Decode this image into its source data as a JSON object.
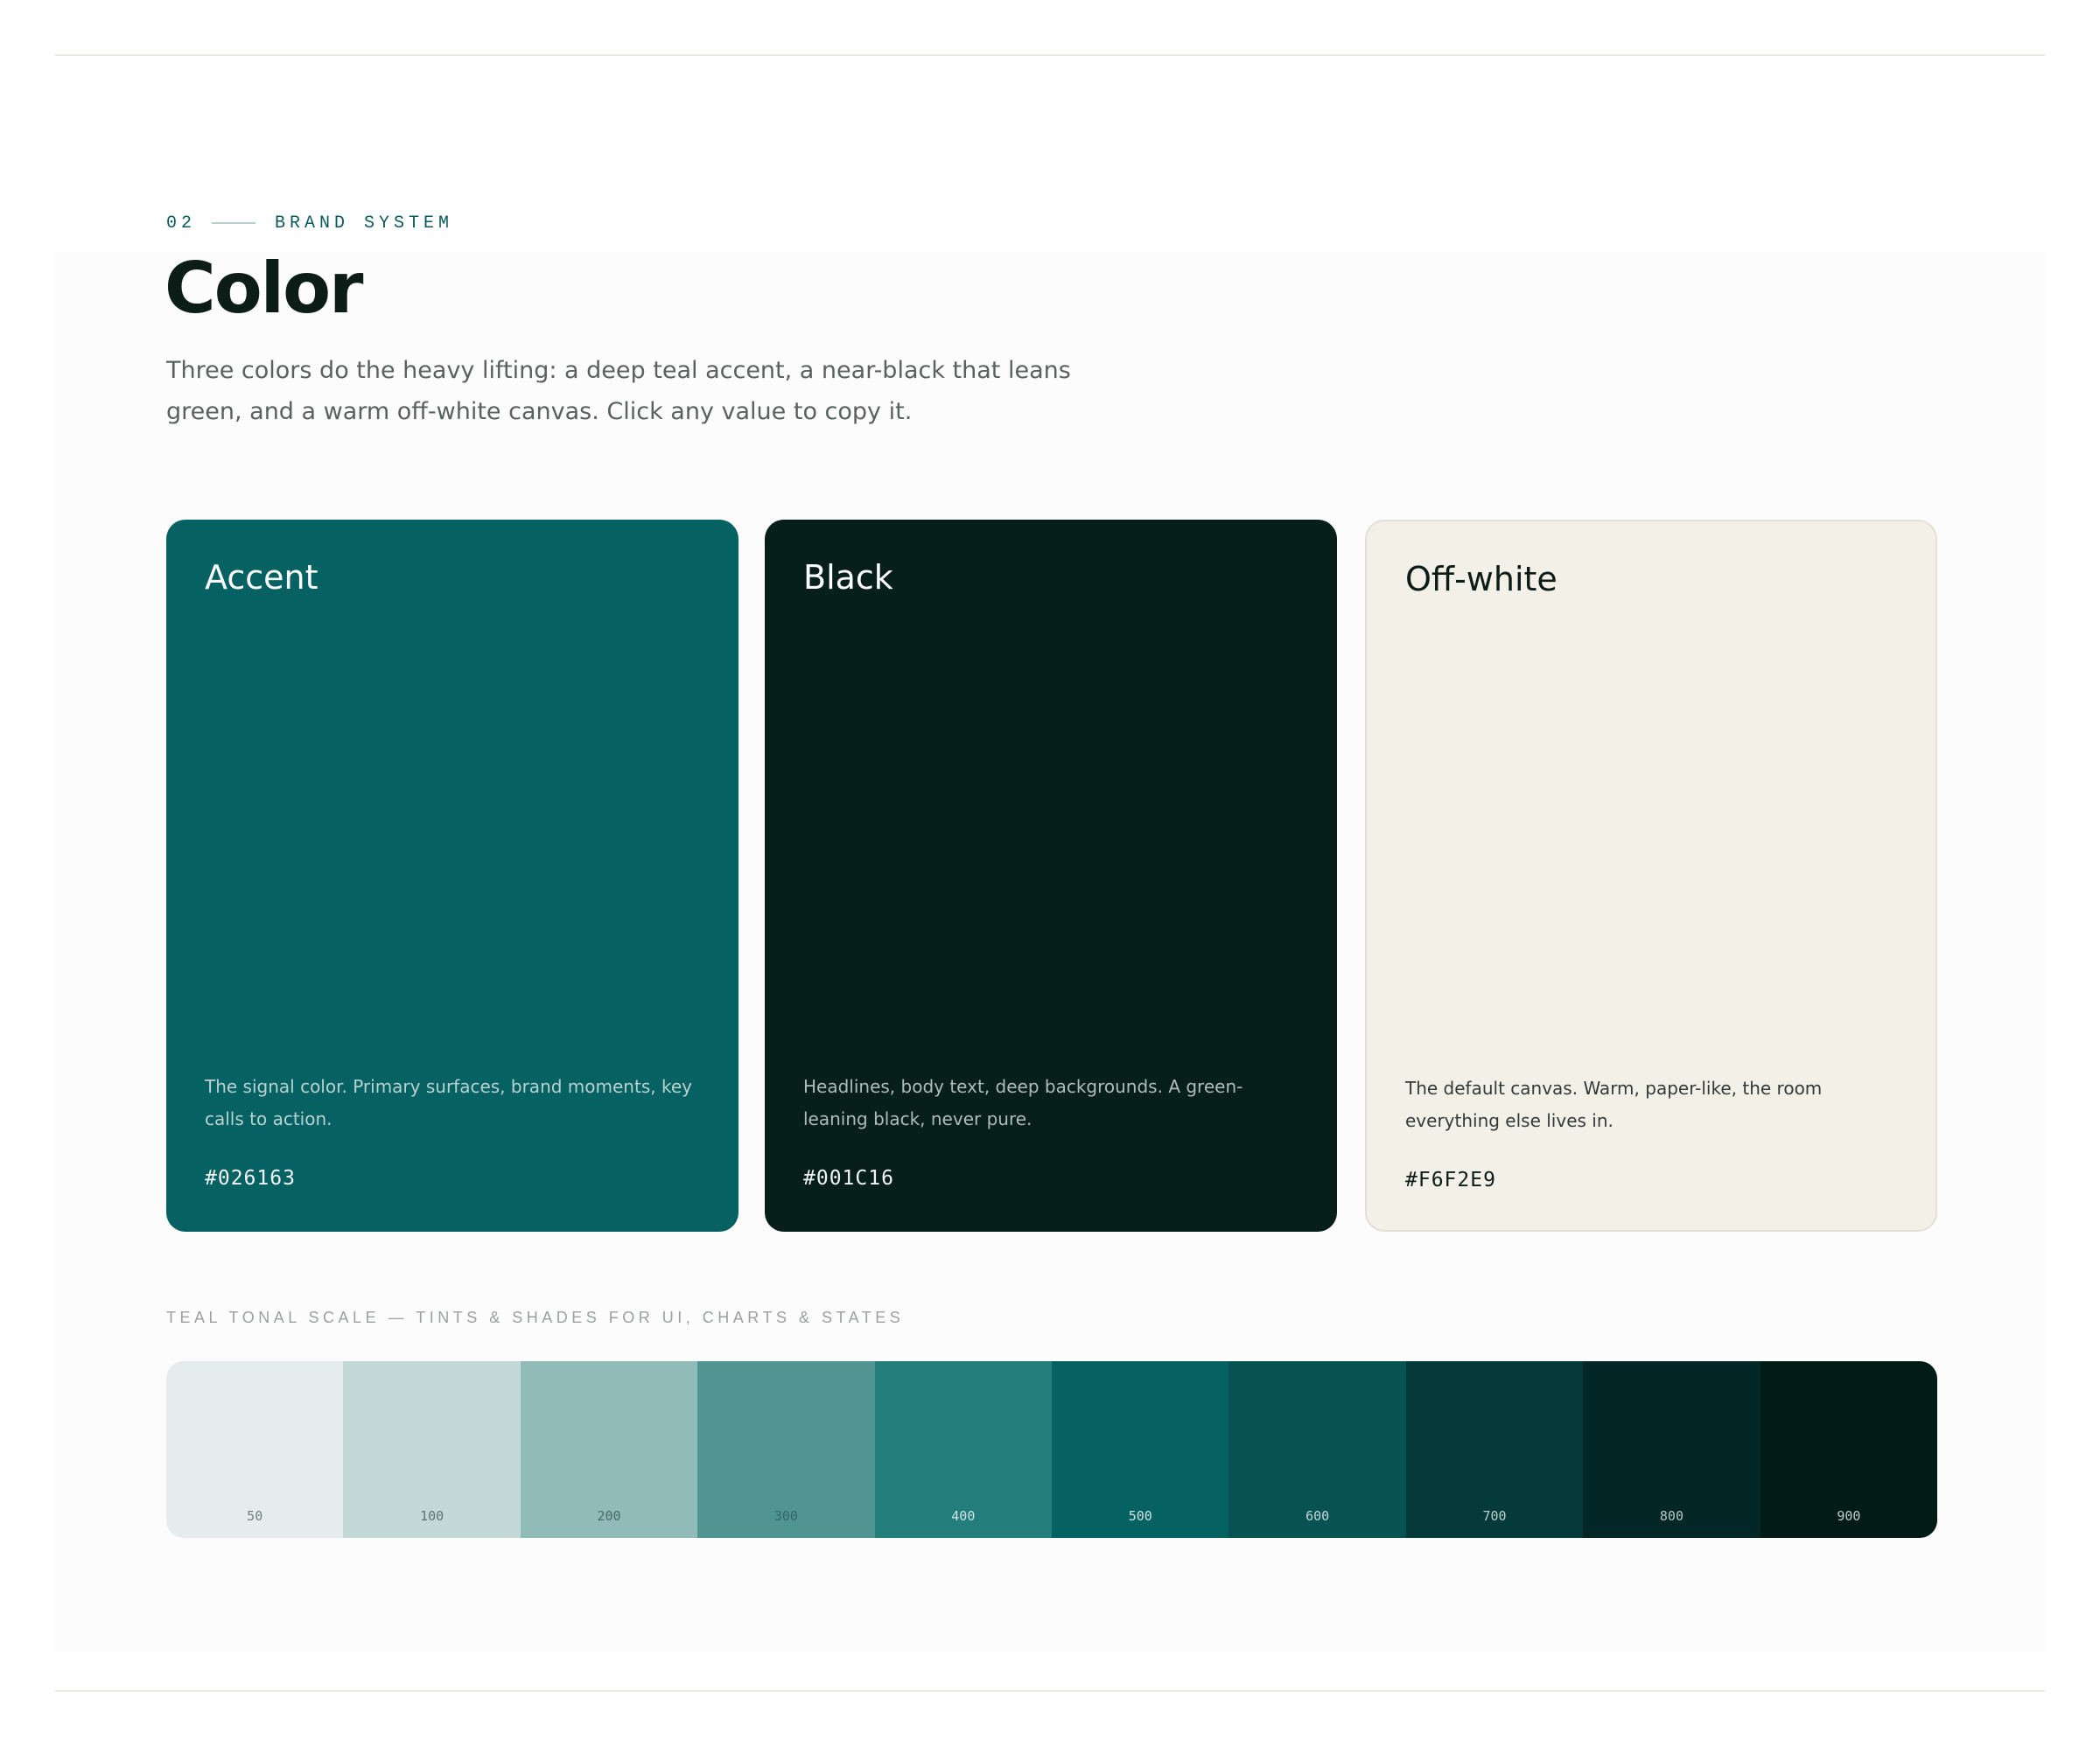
{
  "section": {
    "number": "02",
    "eyebrow": "BRAND SYSTEM",
    "title": "Color",
    "intro": "Three colors do the heavy lifting: a deep teal accent, a near-black that leans green, and a warm off-white canvas. Click any value to copy it."
  },
  "cards": [
    {
      "name": "Accent",
      "description": "The signal color. Primary surfaces, brand moments, key calls to action.",
      "hex": "#026163",
      "color": "#066163"
    },
    {
      "name": "Black",
      "description": "Headlines, body text, deep backgrounds. A green-leaning black, never pure.",
      "hex": "#001C16",
      "color": "#061F19"
    },
    {
      "name": "Off-white",
      "description": "The default canvas. Warm, paper-like, the room everything else lives in.",
      "hex": "#F6F2E9",
      "color": "#F3F0E8"
    }
  ],
  "scale": {
    "label": "TEAL TONAL SCALE — TINTS & SHADES FOR UI, CHARTS & STATES",
    "steps": [
      {
        "label": "50",
        "color": "#E5EDEC",
        "text_color": "#6f7f7c"
      },
      {
        "label": "100",
        "color": "#C2D9D7",
        "text_color": "#5d7471"
      },
      {
        "label": "200",
        "color": "#91BBB9",
        "text_color": "#4a6a68"
      },
      {
        "label": "300",
        "color": "#519592",
        "text_color": "#2f6664"
      },
      {
        "label": "400",
        "color": "#227D7B",
        "text_color": "#cfe5e3"
      },
      {
        "label": "500",
        "color": "#066163",
        "text_color": "#cde2e1"
      },
      {
        "label": "600",
        "color": "#085254",
        "text_color": "#c3d8d7"
      },
      {
        "label": "700",
        "color": "#043A3A",
        "text_color": "#bcd0ce"
      },
      {
        "label": "800",
        "color": "#032626",
        "text_color": "#b8c7c4"
      },
      {
        "label": "900",
        "color": "#011B16",
        "text_color": "#c3cdca"
      }
    ]
  }
}
